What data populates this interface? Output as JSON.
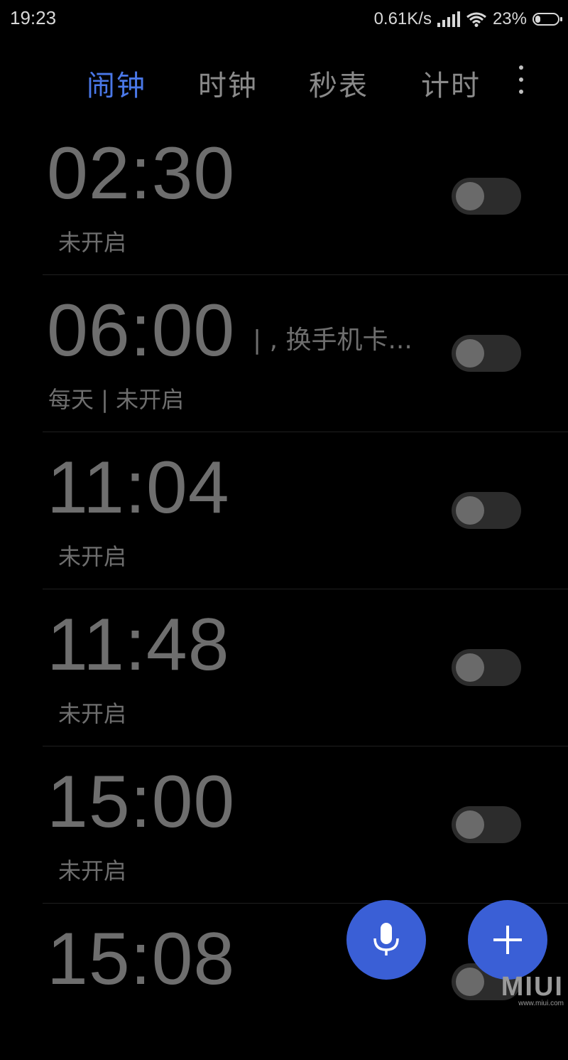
{
  "status_bar": {
    "time": "19:23",
    "net_speed": "0.61K/s",
    "battery_percent": "23%",
    "battery_level": 0.23
  },
  "tabs": [
    {
      "label": "闹钟",
      "active": true
    },
    {
      "label": "时钟",
      "active": false
    },
    {
      "label": "秒表",
      "active": false
    },
    {
      "label": "计时",
      "active": false
    }
  ],
  "alarms": [
    {
      "time": "02:30",
      "label": "",
      "sub": "未开启",
      "enabled": false
    },
    {
      "time": "06:00",
      "label": "| , 换手机卡...",
      "sub": "每天 | 未开启",
      "enabled": false
    },
    {
      "time": "11:04",
      "label": "",
      "sub": "未开启",
      "enabled": false
    },
    {
      "time": "11:48",
      "label": "",
      "sub": "未开启",
      "enabled": false
    },
    {
      "time": "15:00",
      "label": "",
      "sub": "未开启",
      "enabled": false
    },
    {
      "time": "15:08",
      "label": "",
      "sub": "",
      "enabled": false
    }
  ],
  "watermark": {
    "logo": "MIUI",
    "url": "www.miui.com"
  },
  "colors": {
    "accent": "#4a78e8",
    "fab": "#3a5fd6",
    "background": "#000000"
  },
  "icons": {
    "mic": "microphone-icon",
    "add": "plus-icon",
    "more": "more-vertical-icon"
  }
}
